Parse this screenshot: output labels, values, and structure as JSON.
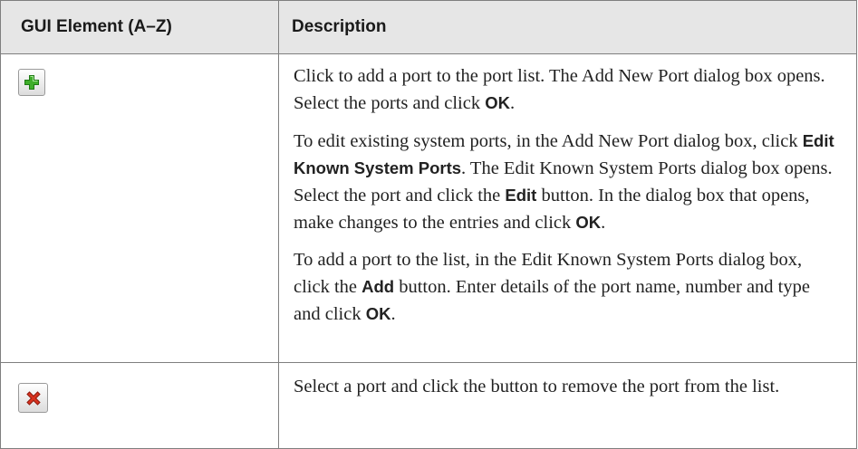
{
  "table": {
    "headers": {
      "element": "GUI Element (A–Z)",
      "description": "Description"
    },
    "rows": [
      {
        "icon": "add-port-icon",
        "paragraphs": [
          {
            "t1": "Click to add a port to the port list. The Add New Port dialog box opens. Select the ports and click ",
            "b1": "OK",
            "t2": "."
          },
          {
            "t1": "To edit existing system ports, in the Add New Port dialog box, click ",
            "b1": "Edit Known System Ports",
            "t2": ". The Edit Known System Ports dialog box opens. Select the port and click the ",
            "b2": "Edit",
            "t3": " button. In the dialog box that opens, make changes to the entries and click ",
            "b3": "OK",
            "t4": "."
          },
          {
            "t1": "To add a port to the list, in the Edit Known System Ports dialog box, click the ",
            "b1": "Add",
            "t2": " button. Enter details of the port name, number and type and click ",
            "b2": "OK",
            "t3": "."
          }
        ]
      },
      {
        "icon": "remove-port-icon",
        "paragraphs": [
          {
            "t1": "Select a port and click the button to remove the port from the list."
          }
        ]
      }
    ]
  },
  "colors": {
    "header_bg": "#e6e6e6",
    "border": "#7f7f7f",
    "add_icon": "#3fae2a",
    "remove_icon": "#d9321f"
  }
}
